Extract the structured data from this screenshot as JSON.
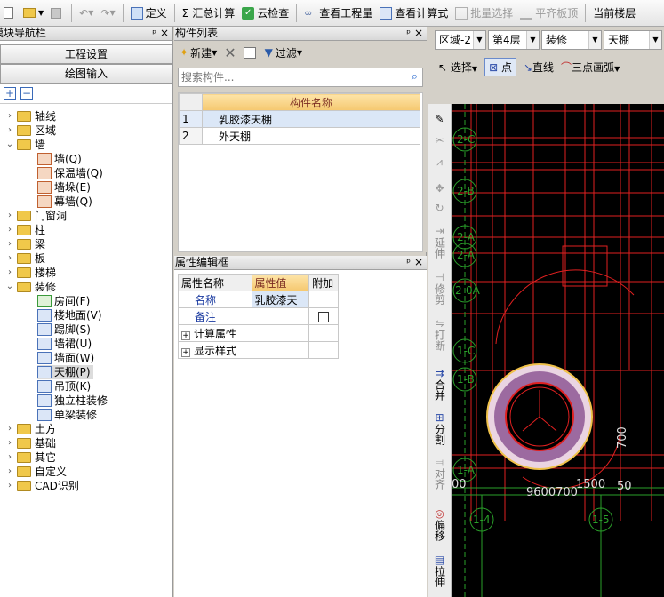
{
  "toolbar": {
    "define": "定义",
    "sum_calc": "汇总计算",
    "cloud_check": "云检查",
    "view_quantity": "查看工程量",
    "view_formula": "查看计算式",
    "batch_select": "批量选择",
    "flush_slab_top": "平齐板顶",
    "current_floor": "当前楼层"
  },
  "left": {
    "title": "模块导航栏",
    "pin": "ᵖ",
    "close": "×",
    "btn_project": "工程设置",
    "btn_draw": "绘图输入",
    "tree": [
      "轴线",
      "区域",
      "墙",
      "墙(Q)",
      "保温墙(Q)",
      "墙垛(E)",
      "幕墙(Q)",
      "门窗洞",
      "柱",
      "梁",
      "板",
      "楼梯",
      "装修",
      "房间(F)",
      "楼地面(V)",
      "踢脚(S)",
      "墙裙(U)",
      "墙面(W)",
      "天棚(P)",
      "吊顶(K)",
      "独立柱装修",
      "单梁装修",
      "土方",
      "基础",
      "其它",
      "自定义",
      "CAD识别"
    ]
  },
  "list": {
    "title": "构件列表",
    "new": "新建",
    "filter": "过滤",
    "search_placeholder": "搜索构件...",
    "col_name": "构件名称",
    "rows": [
      {
        "idx": "1",
        "name": "乳胶漆天棚"
      },
      {
        "idx": "2",
        "name": "外天棚"
      }
    ]
  },
  "props": {
    "title": "属性编辑框",
    "col_name": "属性名称",
    "col_value": "属性值",
    "col_extra": "附加",
    "rows": [
      {
        "name": "名称",
        "value": "乳胶漆天"
      },
      {
        "name": "备注",
        "value": ""
      },
      {
        "name": "计算属性",
        "value": ""
      },
      {
        "name": "显示样式",
        "value": ""
      }
    ]
  },
  "right": {
    "region": "区域-2",
    "floor": "第4层",
    "category": "装修",
    "component": "天棚",
    "select": "选择",
    "point": "点",
    "line": "直线",
    "arc3": "三点画弧",
    "vtools": [
      "延伸",
      "修剪",
      "打断",
      "合并",
      "分割",
      "对齐",
      "偏移",
      "拉伸"
    ]
  },
  "cad": {
    "axis_labels": [
      "2-C",
      "2-B",
      "2-A",
      "2-A",
      "2-0A",
      "1-C",
      "1-B",
      "1-A",
      "1-4",
      "1-5"
    ],
    "dim_texts": [
      "700",
      "9600700",
      "1500",
      "00",
      "50"
    ]
  }
}
